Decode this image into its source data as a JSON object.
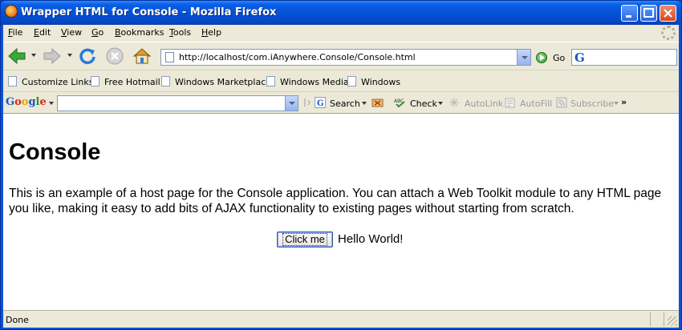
{
  "window": {
    "title": "Wrapper HTML for Console - Mozilla Firefox",
    "controls": [
      "minimize",
      "maximize",
      "close"
    ]
  },
  "menubar": {
    "items": [
      {
        "label": "File",
        "accel": "F"
      },
      {
        "label": "Edit",
        "accel": "E"
      },
      {
        "label": "View",
        "accel": "V"
      },
      {
        "label": "Go",
        "accel": "G"
      },
      {
        "label": "Bookmarks",
        "accel": "B"
      },
      {
        "label": "Tools",
        "accel": "T"
      },
      {
        "label": "Help",
        "accel": "H"
      }
    ]
  },
  "navbar": {
    "back_icon": "back-arrow-icon",
    "forward_icon": "forward-arrow-icon",
    "reload_icon": "reload-icon",
    "stop_icon": "stop-icon",
    "home_icon": "home-icon",
    "url": "http://localhost/com.iAnywhere.Console/Console.html",
    "go_label": "Go"
  },
  "bookmarks": {
    "items": [
      "Customize Links",
      "Free Hotmail",
      "Windows Marketplace",
      "Windows Media",
      "Windows"
    ]
  },
  "google_toolbar": {
    "logo": "Google",
    "search_label": "Search",
    "check_label": "Check",
    "autolink_label": "AutoLink",
    "autofill_label": "AutoFill",
    "subscribe_label": "Subscribe",
    "more_label": "»"
  },
  "page": {
    "heading": "Console",
    "paragraph": "This is an example of a host page for the Console application. You can attach a Web Toolkit module to any HTML page you like, making it easy to add bits of AJAX functionality to existing pages without starting from scratch.",
    "button_label": "Click me",
    "hello_text": "Hello World!"
  },
  "status": {
    "text": "Done"
  },
  "colors": {
    "titlebar": "#0552d6",
    "chrome": "#ece9d8",
    "google_blue": "#1a55c4"
  }
}
